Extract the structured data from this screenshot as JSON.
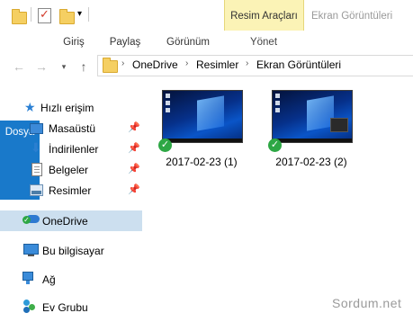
{
  "ribbon": {
    "context_group_label": "Resim Araçları",
    "window_title": "Ekran Görüntüleri",
    "tabs": [
      {
        "label": "Dosya"
      },
      {
        "label": "Giriş"
      },
      {
        "label": "Paylaş"
      },
      {
        "label": "Görünüm"
      },
      {
        "label": "Yönet"
      }
    ]
  },
  "address": {
    "crumbs": [
      "OneDrive",
      "Resimler",
      "Ekran Görüntüleri"
    ]
  },
  "nav_pane": {
    "quick_access": "Hızlı erişim",
    "pinned": [
      "Masaüstü",
      "İndirilenler",
      "Belgeler",
      "Resimler"
    ],
    "onedrive": "OneDrive",
    "this_pc": "Bu bilgisayar",
    "network": "Ağ",
    "homegroup": "Ev Grubu"
  },
  "files": [
    {
      "name": "2017-02-23 (1)",
      "sync_status": "synced"
    },
    {
      "name": "2017-02-23 (2)",
      "sync_status": "synced"
    }
  ],
  "watermark": "Sordum.net",
  "colors": {
    "file_tab": "#1979ca",
    "context_tab": "#fbf3b6",
    "selected_nav": "#ccdfef",
    "sync_badge": "#2da744"
  }
}
